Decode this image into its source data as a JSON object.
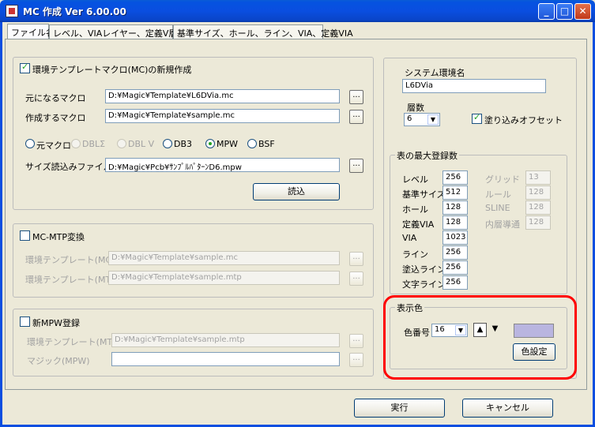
{
  "window": {
    "title": "MC 作成  Ver 6.00.00"
  },
  "tabs": [
    "ファイル名",
    "レベル、VIAレイヤー、定義V層名",
    "基準サイズ、ホール、ライン、VIA、定義VIA"
  ],
  "newmacro": {
    "checkbox_label": "環境テンプレートマクロ(MC)の新規作成",
    "checked": true,
    "source_label": "元になるマクロ",
    "source_value": "D:¥Magic¥Template¥L6DVia.mc",
    "target_label": "作成するマクロ",
    "target_value": "D:¥Magic¥Template¥sample.mc",
    "radios": [
      "元マクロ",
      "DBLΣ",
      "DBL V",
      "DB3",
      "MPW",
      "BSF"
    ],
    "selected_radio": "MPW",
    "sizefile_label": "サイズ読込みファイル",
    "sizefile_value": "D:¥Magic¥Pcb¥ｻﾝﾌﾟﾙﾊﾟﾀｰﾝD6.mpw",
    "load_button": "読込",
    "browse": "..."
  },
  "mcmtp": {
    "checkbox_label": "MC-MTP変換",
    "env_mc_label": "環境テンプレート(MC)",
    "env_mc_value": "D:¥Magic¥Template¥sample.mc",
    "env_mtp_label": "環境テンプレート(MTP)",
    "env_mtp_value": "D:¥Magic¥Template¥sample.mtp"
  },
  "mpw": {
    "checkbox_label": "新MPW登録",
    "env_mtp_label": "環境テンプレート(MTP)",
    "env_mtp_value": "D:¥Magic¥Template¥sample.mtp",
    "magic_label": "マジック(MPW)",
    "magic_value": ""
  },
  "system": {
    "env_name_label": "システム環境名",
    "env_name_value": "L6DVia",
    "layers_label": "層数",
    "layers_value": "6",
    "fill_offset_label": "塗り込みオフセット",
    "fill_offset_checked": true
  },
  "maxcount": {
    "title": "表の最大登録数",
    "left": [
      {
        "label": "レベル",
        "value": "256"
      },
      {
        "label": "基準サイズ",
        "value": "512"
      },
      {
        "label": "ホール",
        "value": "128"
      },
      {
        "label": "定義VIA",
        "value": "128"
      },
      {
        "label": "VIA",
        "value": "1023"
      },
      {
        "label": "ライン",
        "value": "256"
      },
      {
        "label": "塗込ライン",
        "value": "256"
      },
      {
        "label": "文字ライン",
        "value": "256"
      }
    ],
    "right": [
      {
        "label": "グリッド",
        "value": "13"
      },
      {
        "label": "ルール",
        "value": "128"
      },
      {
        "label": "SLINE",
        "value": "128"
      },
      {
        "label": "内層導通",
        "value": "128"
      }
    ]
  },
  "displaycolor": {
    "title": "表示色",
    "number_label": "色番号",
    "number_value": "16",
    "swatch_color": "#b9b5e0",
    "set_button": "色設定",
    "highlight_color": "#ff0000"
  },
  "footer": {
    "run_button": "実行",
    "cancel_button": "キャンセル"
  }
}
